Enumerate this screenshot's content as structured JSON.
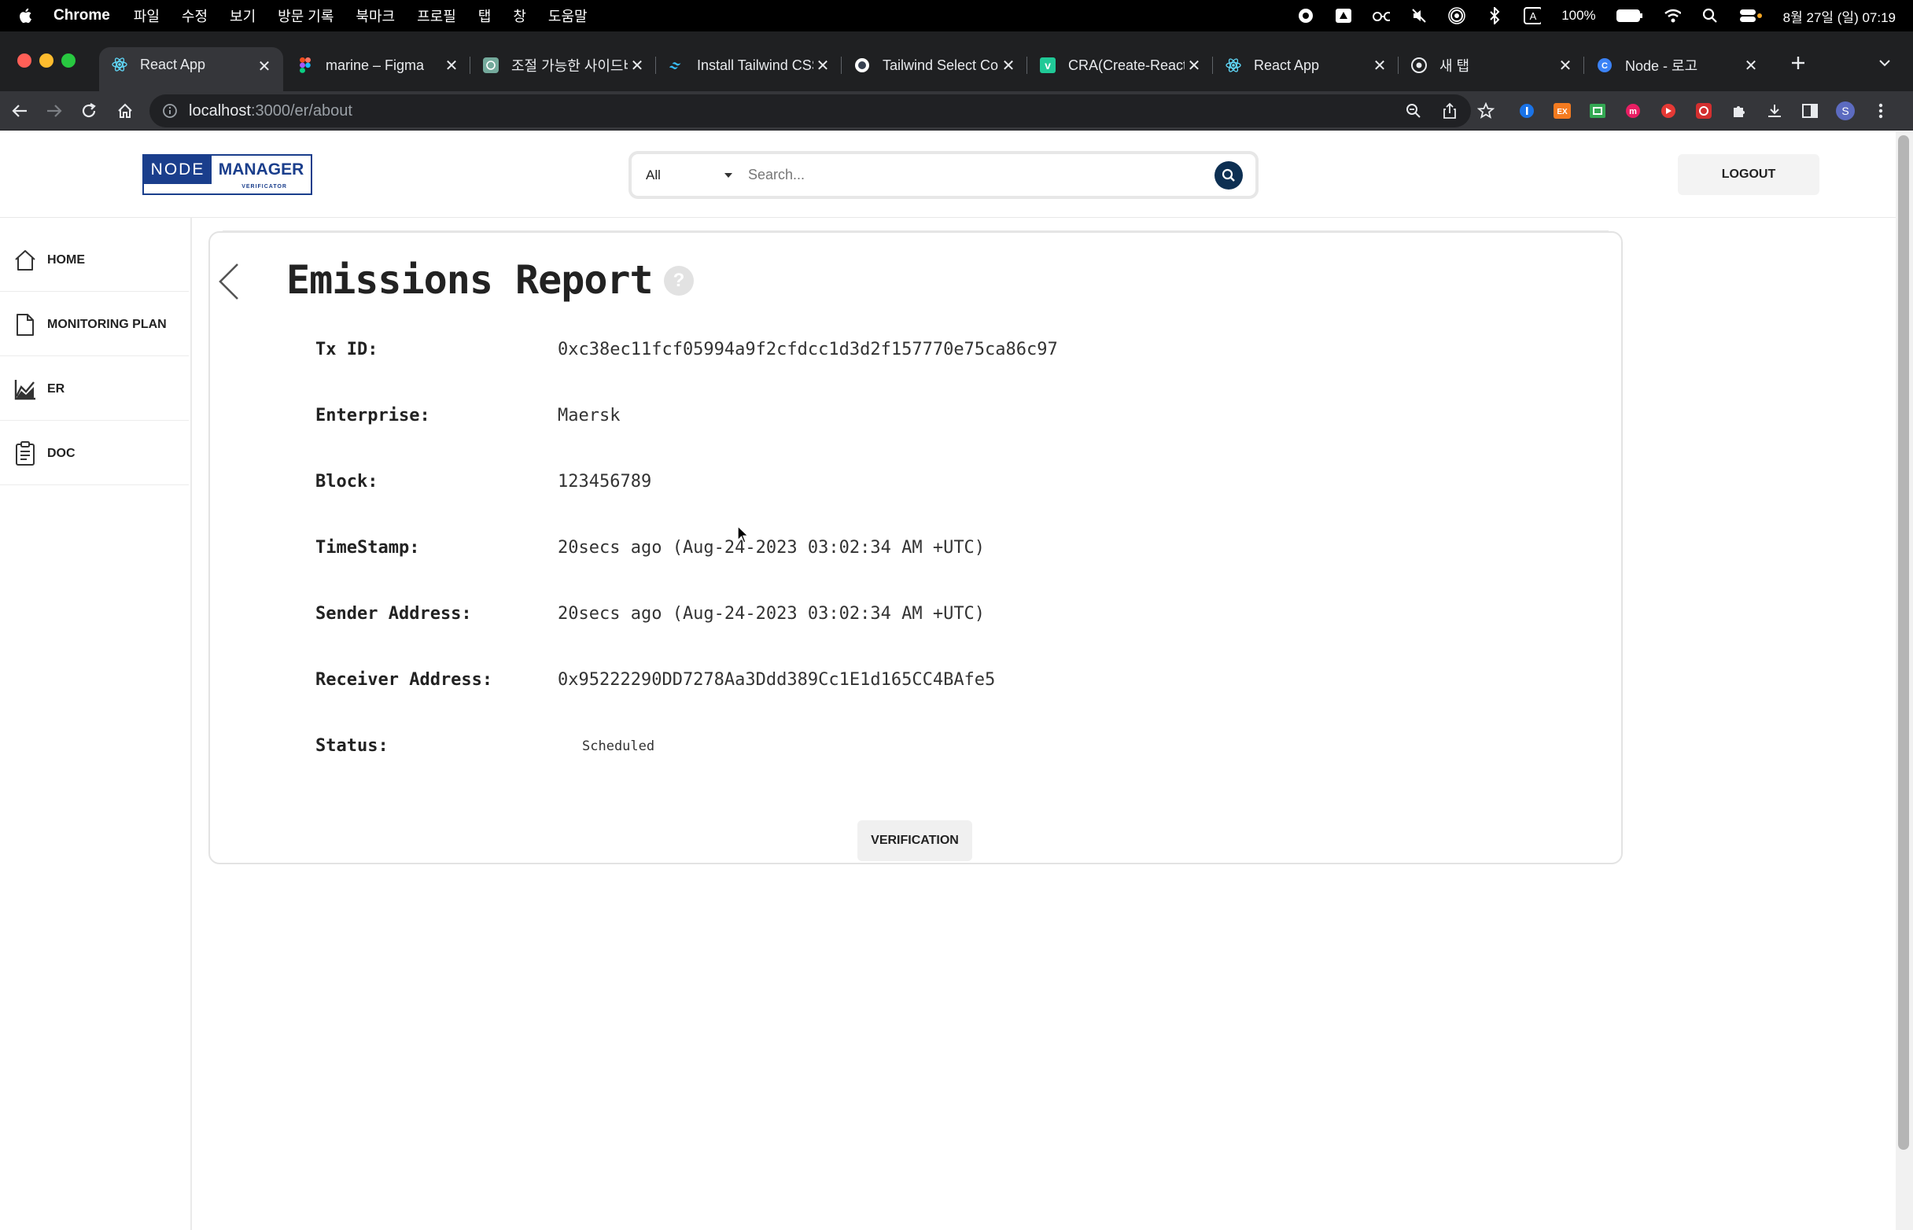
{
  "menubar": {
    "app_name": "Chrome",
    "menus": [
      "파일",
      "수정",
      "보기",
      "방문 기록",
      "북마크",
      "프로필",
      "탭",
      "창",
      "도움말"
    ],
    "battery": "100%",
    "clock": "8월 27일 (일) 07:19"
  },
  "tabs": [
    {
      "title": "React App",
      "active": true,
      "favicon": "react-icon"
    },
    {
      "title": "marine – Figma",
      "active": false,
      "favicon": "figma-icon"
    },
    {
      "title": "조절 가능한 사이드바",
      "active": false,
      "favicon": "chatgpt-icon"
    },
    {
      "title": "Install Tailwind CSS",
      "active": false,
      "favicon": "tailwind-icon"
    },
    {
      "title": "Tailwind Select Co",
      "active": false,
      "favicon": "tailwind-select-icon"
    },
    {
      "title": "CRA(Create-React",
      "active": false,
      "favicon": "velog-icon"
    },
    {
      "title": "React App",
      "active": false,
      "favicon": "react-icon"
    },
    {
      "title": "새 탭",
      "active": false,
      "favicon": "chrome-icon"
    },
    {
      "title": "Node - 로고",
      "active": false,
      "favicon": "canva-icon"
    }
  ],
  "address_bar": {
    "host": "localhost",
    "path": ":3000/er/about"
  },
  "profile_initial": "S",
  "header": {
    "logo_node": "NODE",
    "logo_manager": "MANAGER",
    "logo_sub": "VERIFICATOR",
    "search_category": "All",
    "search_placeholder": "Search...",
    "logout_label": "LOGOUT"
  },
  "sidebar": {
    "items": [
      {
        "label": "HOME",
        "icon": "home-icon"
      },
      {
        "label": "MONITORING PLAN",
        "icon": "document-icon"
      },
      {
        "label": "ER",
        "icon": "chart-icon"
      },
      {
        "label": "DOC",
        "icon": "clipboard-icon"
      }
    ]
  },
  "report": {
    "title": "Emissions Report",
    "help": "?",
    "fields": [
      {
        "label": "Tx ID:",
        "value": "0xc38ec11fcf05994a9f2cfdcc1d3d2f157770e75ca86c97"
      },
      {
        "label": "Enterprise:",
        "value": "Maersk"
      },
      {
        "label": "Block:",
        "value": "123456789"
      },
      {
        "label": "TimeStamp:",
        "value": "20secs ago (Aug-24-2023 03:02:34 AM +UTC)"
      },
      {
        "label": "Sender Address:",
        "value": "20secs ago (Aug-24-2023 03:02:34 AM +UTC)"
      },
      {
        "label": "Receiver Address:",
        "value": "0x95222290DD7278Aa3Ddd389Cc1E1d165CC4BAfe5"
      },
      {
        "label": "Status:",
        "value": "Scheduled"
      }
    ],
    "verify_label": "VERIFICATION"
  },
  "colors": {
    "brand_blue": "#1a3e8c",
    "search_button": "#0d2f52",
    "chrome_dark": "#202124"
  }
}
